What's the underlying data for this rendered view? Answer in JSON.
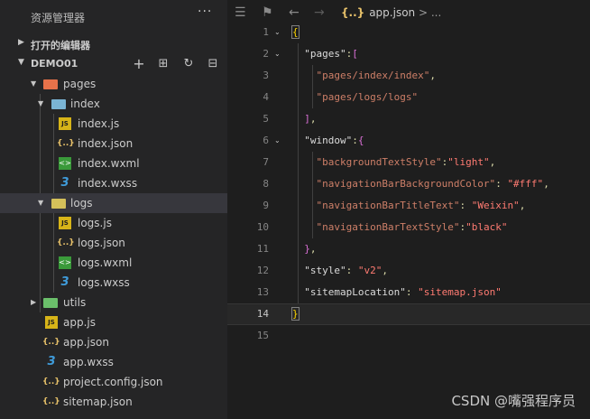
{
  "sidebar": {
    "title": "资源管理器",
    "more": "···",
    "open_editors": "打开的编辑器",
    "project": "DEMO01",
    "actions": {
      "new_file": "+",
      "new_folder": "⊞",
      "refresh": "↻",
      "collapse": "⊟"
    },
    "tree": [
      {
        "name": "pages"
      },
      {
        "name": "index"
      },
      {
        "name": "index.js"
      },
      {
        "name": "index.json"
      },
      {
        "name": "index.wxml"
      },
      {
        "name": "index.wxss"
      },
      {
        "name": "logs"
      },
      {
        "name": "logs.js"
      },
      {
        "name": "logs.json"
      },
      {
        "name": "logs.wxml"
      },
      {
        "name": "logs.wxss"
      },
      {
        "name": "utils"
      },
      {
        "name": "app.js"
      },
      {
        "name": "app.json"
      },
      {
        "name": "app.wxss"
      },
      {
        "name": "project.config.json"
      },
      {
        "name": "sitemap.json"
      }
    ]
  },
  "editor": {
    "breadcrumb_file": "app.json",
    "breadcrumb_sep": ">",
    "breadcrumb_more": "...",
    "line_numbers": [
      "1",
      "2",
      "3",
      "4",
      "5",
      "6",
      "7",
      "8",
      "9",
      "10",
      "11",
      "12",
      "13",
      "14",
      "15"
    ],
    "code": {
      "l1_brace": "{",
      "l2_key": "\"pages\"",
      "l2_punct": ":",
      "l2_bracket": "[",
      "l3_str": "\"pages/index/index\"",
      "l3_punct": ",",
      "l4_str": "\"pages/logs/logs\"",
      "l5_bracket": "]",
      "l5_punct": ",",
      "l6_key": "\"window\"",
      "l6_punct": ":",
      "l6_brace": "{",
      "l7_key": "\"backgroundTextStyle\"",
      "l7_punct": ":",
      "l7_val": "\"light\"",
      "l7_end": ",",
      "l8_key": "\"navigationBarBackgroundColor\"",
      "l8_punct": ": ",
      "l8_val": "\"#fff\"",
      "l8_end": ",",
      "l9_key": "\"navigationBarTitleText\"",
      "l9_punct": ": ",
      "l9_val": "\"Weixin\"",
      "l9_end": ",",
      "l10_key": "\"navigationBarTextStyle\"",
      "l10_punct": ":",
      "l10_val": "\"black\"",
      "l11_brace": "}",
      "l11_punct": ",",
      "l12_key": "\"style\"",
      "l12_punct": ": ",
      "l12_val": "\"v2\"",
      "l12_end": ",",
      "l13_key": "\"sitemapLocation\"",
      "l13_punct": ": ",
      "l13_val": "\"sitemap.json\"",
      "l14_brace": "}"
    }
  },
  "watermark": "CSDN @嘴强程序员"
}
